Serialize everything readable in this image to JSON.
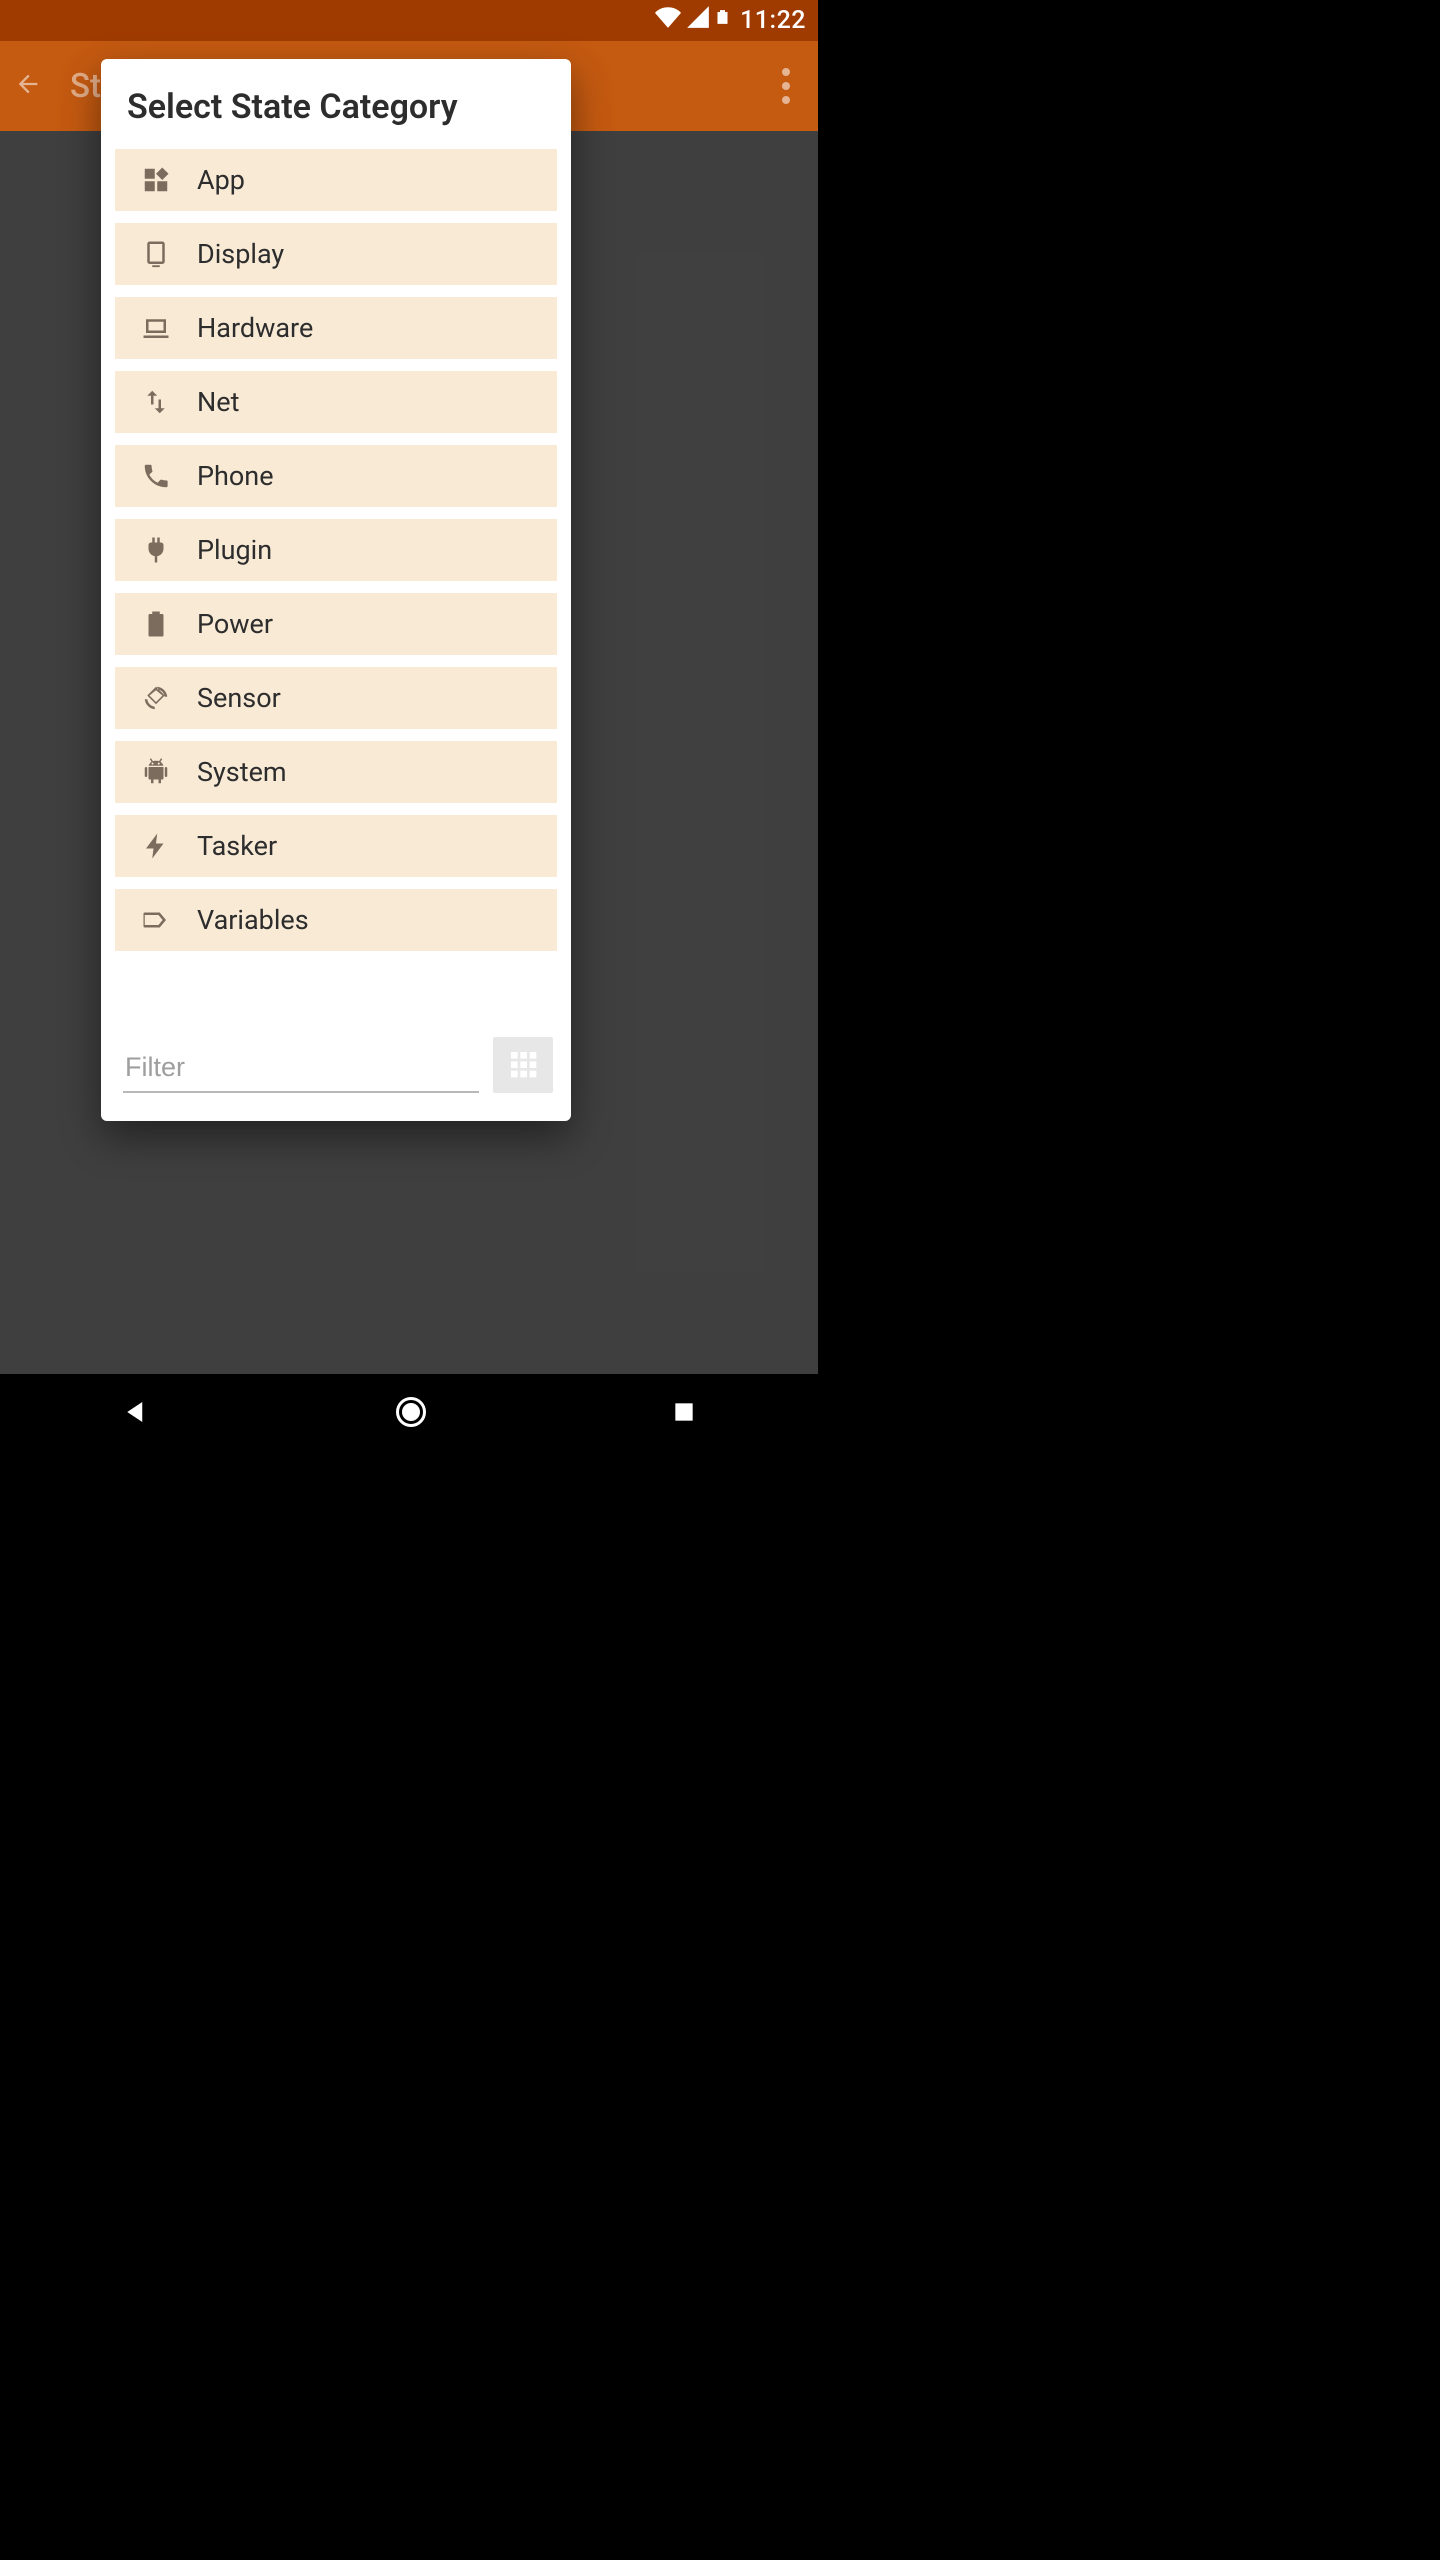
{
  "status": {
    "time": "11:22"
  },
  "appbar": {
    "title": "State Edit"
  },
  "dialog": {
    "title": "Select State Category",
    "categories": [
      {
        "label": "App",
        "icon": "widgets-icon"
      },
      {
        "label": "Display",
        "icon": "display-icon"
      },
      {
        "label": "Hardware",
        "icon": "laptop-icon"
      },
      {
        "label": "Net",
        "icon": "swap-vert-icon"
      },
      {
        "label": "Phone",
        "icon": "phone-icon"
      },
      {
        "label": "Plugin",
        "icon": "plug-icon"
      },
      {
        "label": "Power",
        "icon": "battery-icon"
      },
      {
        "label": "Sensor",
        "icon": "rotation-icon"
      },
      {
        "label": "System",
        "icon": "android-icon"
      },
      {
        "label": "Tasker",
        "icon": "bolt-icon"
      },
      {
        "label": "Variables",
        "icon": "label-icon"
      }
    ],
    "filter_placeholder": "Filter"
  }
}
